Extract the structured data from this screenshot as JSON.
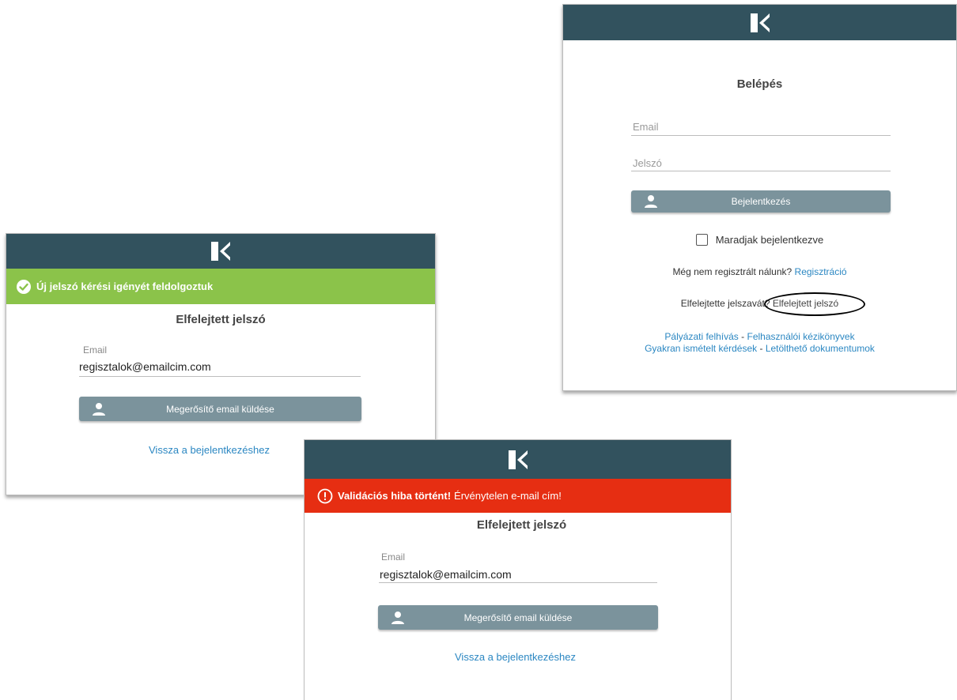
{
  "brand_logo": "K",
  "login": {
    "title": "Belépés",
    "email_placeholder": "Email",
    "password_placeholder": "Jelszó",
    "login_button": "Bejelentkezés",
    "remember_me": "Maradjak bejelentkezve",
    "register_question": "Még nem regisztrált nálunk?",
    "register_link": "Regisztráció",
    "forgot_question": "Elfelejtette jelszavát?",
    "forgot_link": "Elfelejtett jelszó",
    "links_row1": [
      "Pályázati felhívás",
      "Felhasználói kézikönyvek"
    ],
    "links_row2": [
      "Gyakran ismételt kérdések",
      "Letölthető dokumentumok"
    ],
    "separator": "-"
  },
  "success_panel": {
    "banner_text": "Új jelszó kérési igényét feldolgoztuk",
    "title": "Elfelejtett jelszó",
    "email_label": "Email",
    "email_value": "regisztalok@emailcim.com",
    "submit_button": "Megerősítő email küldése",
    "back_link": "Vissza a bejelentkezéshez"
  },
  "error_panel": {
    "banner_bold": "Validációs hiba történt!",
    "banner_text": "Érvénytelen e-mail cím!",
    "title": "Elfelejtett jelszó",
    "email_label": "Email",
    "email_value": "regisztalok@emailcim.com",
    "submit_button": "Megerősítő email küldése",
    "back_link": "Vissza a bejelentkezéshez"
  },
  "colors": {
    "header": "#32525e",
    "success": "#8bc34a",
    "error": "#e62e12",
    "button": "#7b939c",
    "link": "#2b87c2"
  },
  "icons": [
    "k-logo-icon",
    "check-circle-icon",
    "alert-circle-icon",
    "user-icon",
    "checkbox-icon"
  ]
}
